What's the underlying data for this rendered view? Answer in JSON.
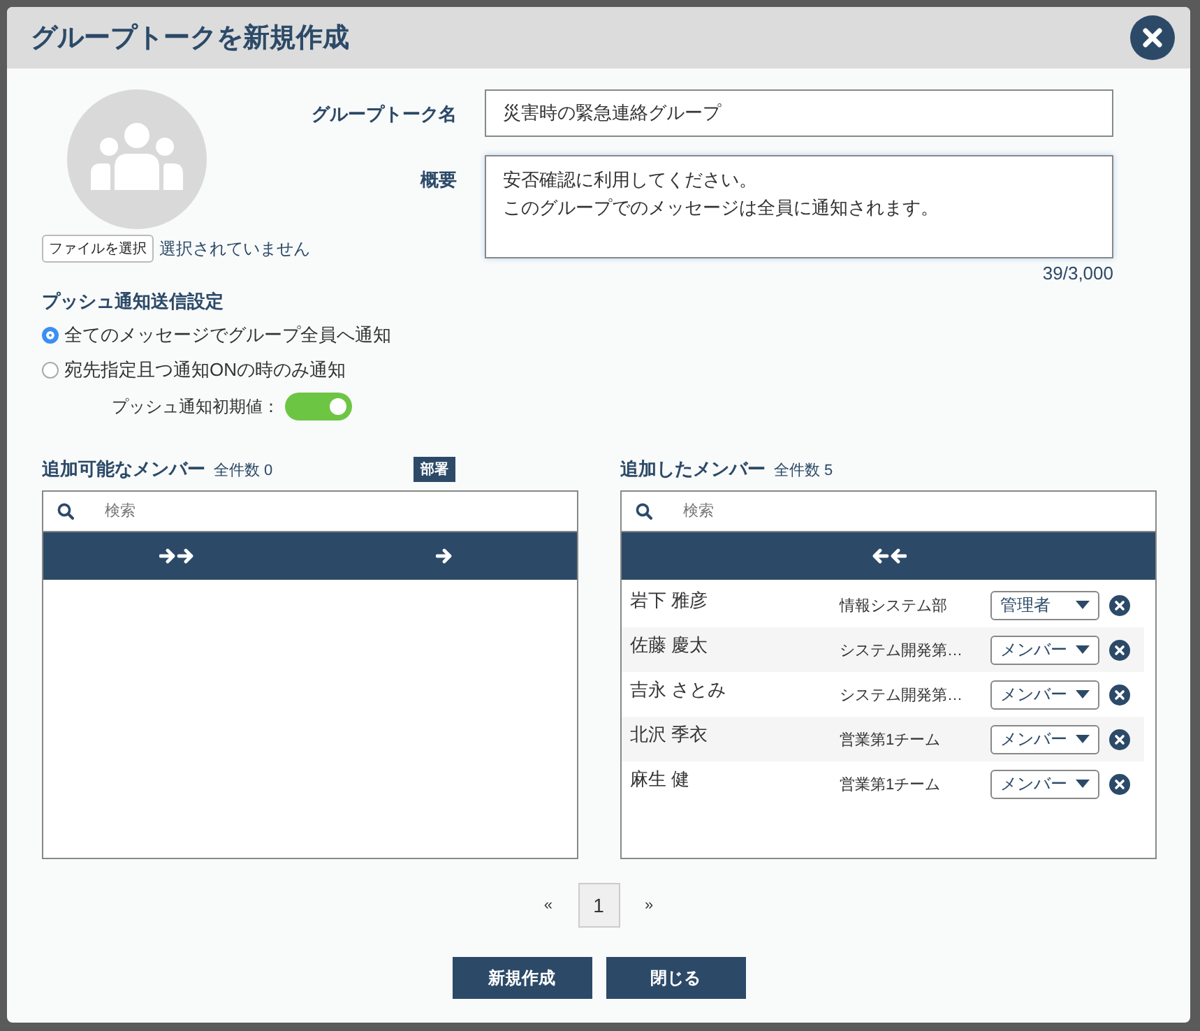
{
  "dialog": {
    "title": "グループトークを新規作成"
  },
  "avatar": {
    "file_button": "ファイルを選択",
    "file_status": "選択されていません"
  },
  "form": {
    "name_label": "グループトーク名",
    "name_value": "災害時の緊急連絡グループ",
    "summary_label": "概要",
    "summary_lines": [
      "安否確認に利用してください。",
      "このグループでのメッセージは全員に通知されます。"
    ],
    "counter": "39/3,000"
  },
  "push": {
    "title": "プッシュ通知送信設定",
    "options": [
      {
        "label": "全てのメッセージでグループ全員へ通知",
        "selected": true
      },
      {
        "label": "宛先指定且つ通知ONの時のみ通知",
        "selected": false
      }
    ],
    "default_label": "プッシュ通知初期値：",
    "default_on": true
  },
  "available": {
    "title": "追加可能なメンバー",
    "count": "全件数 0",
    "dept_button": "部署",
    "search_placeholder": "検索"
  },
  "added": {
    "title": "追加したメンバー",
    "count": "全件数 5",
    "search_placeholder": "検索",
    "members": [
      {
        "name": "岩下 雅彦",
        "department": "情報システム部",
        "role": "管理者"
      },
      {
        "name": "佐藤 慶太",
        "department": "システム開発第…",
        "role": "メンバー"
      },
      {
        "name": "吉永 さとみ",
        "department": "システム開発第…",
        "role": "メンバー"
      },
      {
        "name": "北沢 季衣",
        "department": "営業第1チーム",
        "role": "メンバー"
      },
      {
        "name": "麻生 健",
        "department": "営業第1チーム",
        "role": "メンバー"
      }
    ]
  },
  "pagination": {
    "prev": "«",
    "pages": [
      {
        "label": "1",
        "selected": true
      }
    ],
    "next": "»"
  },
  "buttons": [
    "新規作成",
    "閉じる"
  ]
}
